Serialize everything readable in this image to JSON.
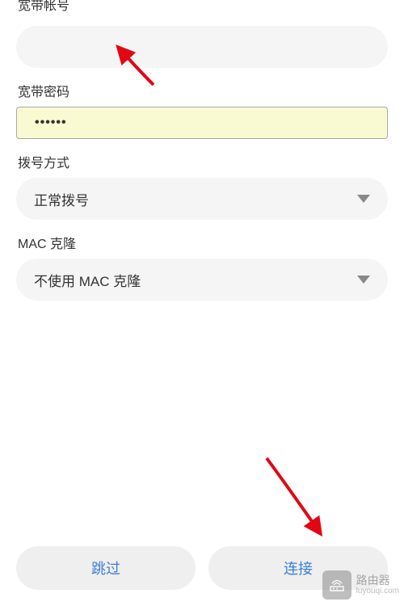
{
  "form": {
    "account_label": "宽带帐号",
    "account_value": "",
    "password_label": "宽带密码",
    "password_value": "••••••",
    "dial_method_label": "拨号方式",
    "dial_method_value": "正常拨号",
    "mac_clone_label": "MAC 克隆",
    "mac_clone_value": "不使用 MAC 克隆"
  },
  "buttons": {
    "skip": "跳过",
    "connect": "连接"
  },
  "watermark": {
    "title": "路由器",
    "url": "luyouqi.com"
  }
}
